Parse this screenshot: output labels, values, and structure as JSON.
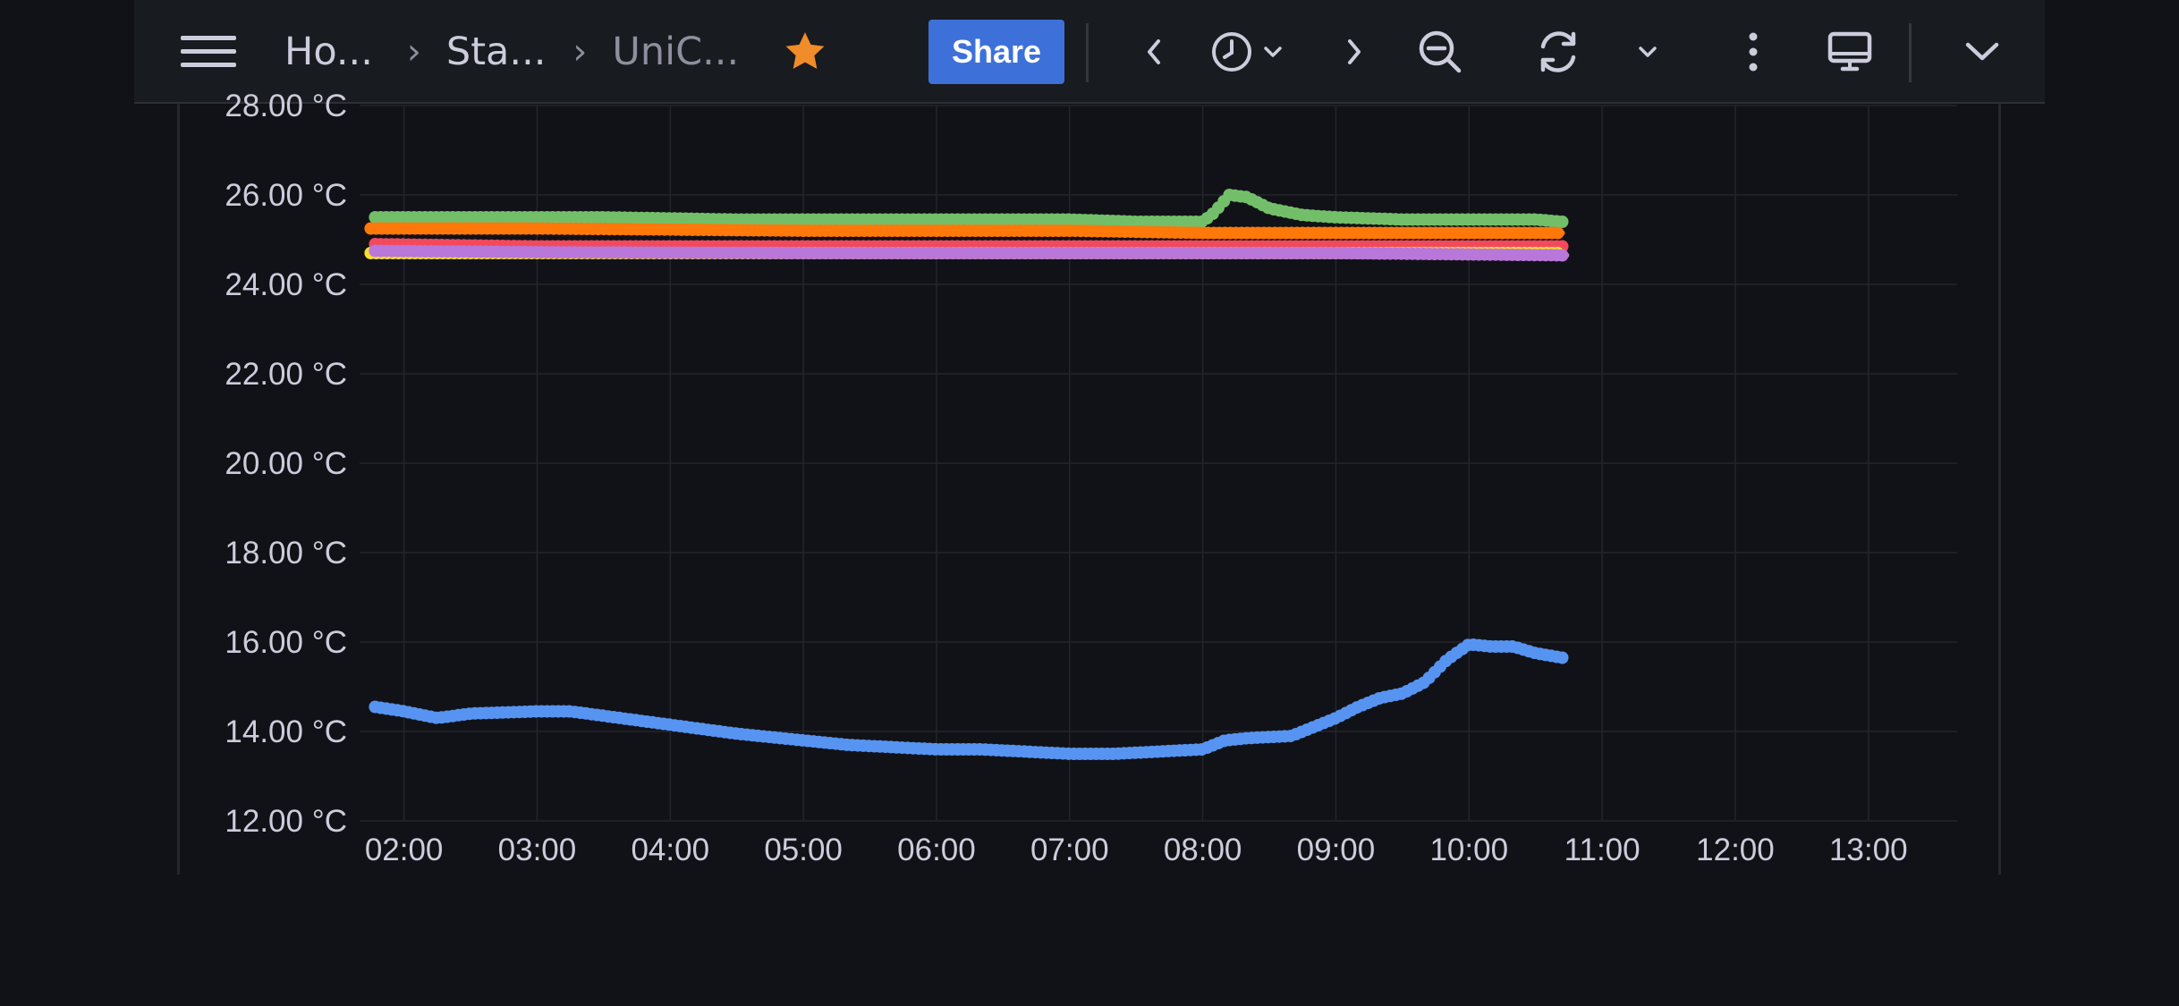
{
  "toolbar": {
    "breadcrumbs": [
      "Ho...",
      "Sta...",
      "UniC..."
    ],
    "share_label": "Share"
  },
  "colors": {
    "background": "#111217",
    "toolbar_bg": "#181b1f",
    "accent_blue": "#3d71d9",
    "star": "#f08c2a",
    "grid": "#23252b"
  },
  "chart_data": {
    "type": "line",
    "y_unit": "°C",
    "ylim": [
      12,
      28
    ],
    "yticks": [
      "28.00 °C",
      "26.00 °C",
      "24.00 °C",
      "22.00 °C",
      "20.00 °C",
      "18.00 °C",
      "16.00 °C",
      "14.00 °C",
      "12.00 °C"
    ],
    "ytick_values": [
      28,
      26,
      24,
      22,
      20,
      18,
      16,
      14,
      12
    ],
    "xticks": [
      "02:00",
      "03:00",
      "04:00",
      "05:00",
      "06:00",
      "07:00",
      "08:00",
      "09:00",
      "10:00",
      "11:00",
      "12:00",
      "13:00"
    ],
    "xlim": [
      "01:40",
      "13:40"
    ],
    "grid": true,
    "series": [
      {
        "color": "#73bf69",
        "x": [
          "01:47",
          "02:30",
          "03:30",
          "04:30",
          "05:30",
          "06:30",
          "07:00",
          "07:30",
          "08:00",
          "08:05",
          "08:12",
          "08:20",
          "08:30",
          "08:45",
          "09:00",
          "09:30",
          "10:00",
          "10:30",
          "10:42"
        ],
        "y": [
          25.5,
          25.5,
          25.5,
          25.45,
          25.45,
          25.45,
          25.45,
          25.4,
          25.4,
          25.6,
          26.0,
          25.95,
          25.7,
          25.55,
          25.5,
          25.45,
          25.45,
          25.45,
          25.4
        ]
      },
      {
        "color": "#ff780a",
        "x": [
          "01:45",
          "03:00",
          "05:00",
          "07:00",
          "08:00",
          "09:00",
          "10:00",
          "10:42"
        ],
        "y": [
          25.25,
          25.25,
          25.2,
          25.2,
          25.15,
          25.15,
          25.15,
          25.15
        ]
      },
      {
        "color": "#f2495c",
        "x": [
          "01:47",
          "03:00",
          "05:00",
          "07:00",
          "08:30",
          "10:00",
          "10:42"
        ],
        "y": [
          24.9,
          24.85,
          24.85,
          24.85,
          24.85,
          24.85,
          24.85
        ]
      },
      {
        "color": "#fade2a",
        "x": [
          "01:45",
          "03:00",
          "05:00",
          "07:00",
          "09:00",
          "10:42"
        ],
        "y": [
          24.7,
          24.7,
          24.7,
          24.7,
          24.7,
          24.7
        ]
      },
      {
        "color": "#b877d9",
        "x": [
          "01:47",
          "03:00",
          "05:00",
          "07:00",
          "09:00",
          "10:44"
        ],
        "y": [
          24.75,
          24.72,
          24.7,
          24.7,
          24.7,
          24.65
        ]
      },
      {
        "color": "#5794f2",
        "x": [
          "01:47",
          "02:00",
          "02:15",
          "02:30",
          "03:00",
          "03:15",
          "03:30",
          "04:00",
          "04:30",
          "05:00",
          "05:20",
          "05:40",
          "06:00",
          "06:20",
          "06:40",
          "07:00",
          "07:20",
          "07:40",
          "08:00",
          "08:10",
          "08:20",
          "08:40",
          "09:00",
          "09:10",
          "09:20",
          "09:30",
          "09:40",
          "09:50",
          "10:00",
          "10:10",
          "10:20",
          "10:30",
          "10:42"
        ],
        "y": [
          14.55,
          14.45,
          14.3,
          14.4,
          14.45,
          14.45,
          14.35,
          14.15,
          13.95,
          13.8,
          13.7,
          13.65,
          13.6,
          13.6,
          13.55,
          13.5,
          13.5,
          13.55,
          13.6,
          13.8,
          13.85,
          13.9,
          14.3,
          14.55,
          14.75,
          14.85,
          15.1,
          15.6,
          15.95,
          15.9,
          15.9,
          15.75,
          15.65
        ]
      }
    ]
  }
}
